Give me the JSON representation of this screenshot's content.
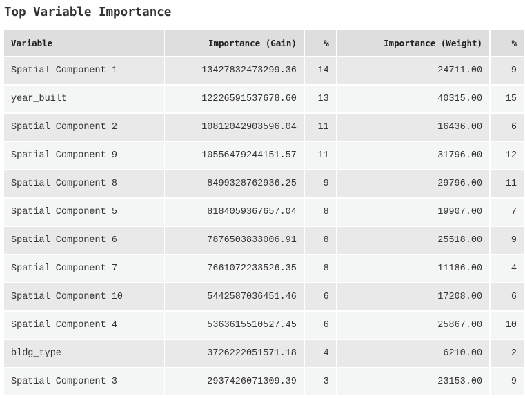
{
  "title": "Top Variable Importance",
  "columns": [
    "Variable",
    "Importance (Gain)",
    "%",
    "Importance (Weight)",
    "%"
  ],
  "rows": [
    [
      "Spatial Component 1",
      "13427832473299.36",
      "14",
      "24711.00",
      "9"
    ],
    [
      "year_built",
      "12226591537678.60",
      "13",
      "40315.00",
      "15"
    ],
    [
      "Spatial Component 2",
      "10812042903596.04",
      "11",
      "16436.00",
      "6"
    ],
    [
      "Spatial Component 9",
      "10556479244151.57",
      "11",
      "31796.00",
      "12"
    ],
    [
      "Spatial Component 8",
      "8499328762936.25",
      "9",
      "29796.00",
      "11"
    ],
    [
      "Spatial Component 5",
      "8184059367657.04",
      "8",
      "19907.00",
      "7"
    ],
    [
      "Spatial Component 6",
      "7876503833006.91",
      "8",
      "25518.00",
      "9"
    ],
    [
      "Spatial Component 7",
      "7661072233526.35",
      "8",
      "11186.00",
      "4"
    ],
    [
      "Spatial Component 10",
      "5442587036451.46",
      "6",
      "17208.00",
      "6"
    ],
    [
      "Spatial Component 4",
      "5363615510527.45",
      "6",
      "25867.00",
      "10"
    ],
    [
      "bldg_type",
      "3726222051571.18",
      "4",
      "6210.00",
      "2"
    ],
    [
      "Spatial Component 3",
      "2937426071309.39",
      "3",
      "23153.00",
      "9"
    ]
  ]
}
